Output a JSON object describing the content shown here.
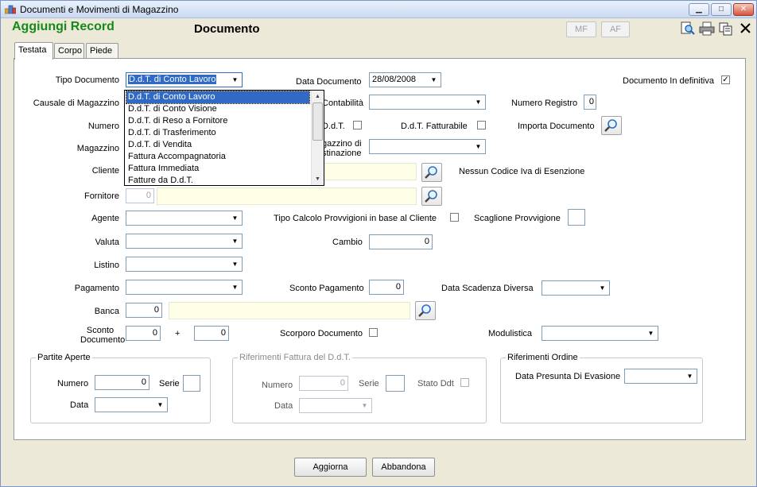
{
  "window": {
    "title": "Documenti e Movimenti di Magazzino",
    "buttons": {
      "minimize": "▁",
      "maximize": "□",
      "close": "✕"
    }
  },
  "header": {
    "mode_title": "Aggiungi Record",
    "doc_title": "Documento",
    "mf_label": "MF",
    "af_label": "AF"
  },
  "tabs": [
    "Testata",
    "Corpo",
    "Piede"
  ],
  "form": {
    "tipo_documento": {
      "label": "Tipo Documento",
      "value": "D.d.T. di Conto Lavoro"
    },
    "data_documento": {
      "label": "Data Documento",
      "value": "28/08/2008"
    },
    "documento_definitiva": {
      "label": "Documento In definitiva",
      "checked": true
    },
    "causale_magazzino": {
      "label": "Causale di Magazzino"
    },
    "causale_contabilita": {
      "label": "Contabilità"
    },
    "numero_registro": {
      "label": "Numero Registro",
      "value": "0"
    },
    "numero": {
      "label": "Numero"
    },
    "ddt": {
      "label": "D.d.T."
    },
    "ddt_fatturabile": {
      "label": "D.d.T.  Fatturabile"
    },
    "importa_documento": {
      "label": "Importa Documento"
    },
    "magazzino": {
      "label": "Magazzino"
    },
    "magazzino_destinazione": {
      "label_1": "gazzino di",
      "label_2": "stinazione"
    },
    "cliente": {
      "label": "Cliente"
    },
    "esenzione": "Nessun Codice Iva di Esenzione",
    "fornitore": {
      "label": "Fornitore",
      "value": "0"
    },
    "agente": {
      "label": "Agente"
    },
    "tipo_calcolo": {
      "label": "Tipo Calcolo Provvigioni in base al Cliente"
    },
    "scaglione": {
      "label": "Scaglione Provvigione"
    },
    "valuta": {
      "label": "Valuta"
    },
    "cambio": {
      "label": "Cambio",
      "value": "0"
    },
    "listino": {
      "label": "Listino"
    },
    "pagamento": {
      "label": "Pagamento"
    },
    "sconto_pagamento": {
      "label": "Sconto Pagamento",
      "value": "0"
    },
    "data_scadenza": {
      "label": "Data Scadenza Diversa"
    },
    "banca": {
      "label": "Banca",
      "value": "0"
    },
    "sconto_documento": {
      "label_1": "Sconto",
      "label_2": "Documento",
      "value_1": "0",
      "plus": "+",
      "value_2": "0"
    },
    "scorporo": {
      "label": "Scorporo Documento"
    },
    "modulistica": {
      "label": "Modulistica"
    }
  },
  "groups": {
    "partite_aperte": {
      "title": "Partite Aperte",
      "numero_label": "Numero",
      "numero_value": "0",
      "serie_label": "Serie",
      "data_label": "Data"
    },
    "riferimenti_fattura": {
      "title": "Riferimenti  Fattura del D.d.T.",
      "numero_label": "Numero",
      "numero_value": "0",
      "serie_label": "Serie",
      "stato_label": "Stato Ddt",
      "data_label": "Data"
    },
    "riferimenti_ordine": {
      "title": "Riferimenti Ordine",
      "data_label": "Data Presunta Di Evasione"
    }
  },
  "dropdown_options": [
    "D.d.T. di Conto Lavoro",
    "D.d.T. di Conto Visione",
    "D.d.T. di Reso a Fornitore",
    "D.d.T. di Trasferimento",
    "D.d.T. di Vendita",
    "Fattura Accompagnatoria",
    "Fattura Immediata",
    "Fatture da D.d.T."
  ],
  "footer": {
    "aggiorna": "Aggiorna",
    "abbandona": "Abbandona"
  },
  "colors": {
    "title_green": "#16891c",
    "selection": "#316ac5",
    "client_field": "#ffffe8"
  },
  "icons": [
    "find-icon",
    "print-icon",
    "copy-icon",
    "close-icon",
    "magnifier-icon"
  ]
}
